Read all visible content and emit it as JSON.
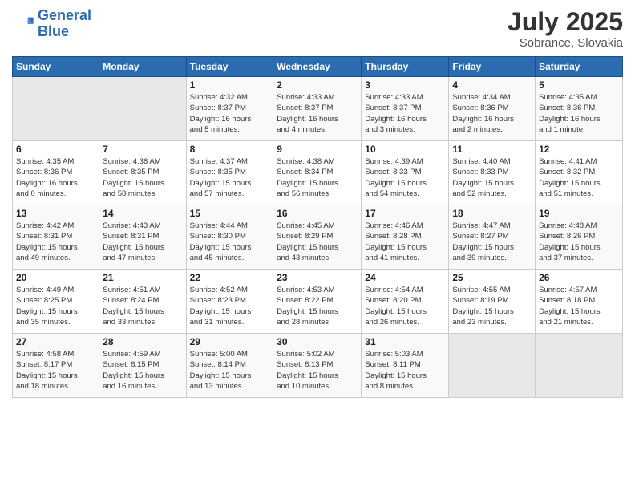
{
  "header": {
    "logo_line1": "General",
    "logo_line2": "Blue",
    "month": "July 2025",
    "location": "Sobrance, Slovakia"
  },
  "columns": [
    "Sunday",
    "Monday",
    "Tuesday",
    "Wednesday",
    "Thursday",
    "Friday",
    "Saturday"
  ],
  "weeks": [
    {
      "days": [
        {
          "num": "",
          "info": ""
        },
        {
          "num": "",
          "info": ""
        },
        {
          "num": "1",
          "info": "Sunrise: 4:32 AM\nSunset: 8:37 PM\nDaylight: 16 hours\nand 5 minutes."
        },
        {
          "num": "2",
          "info": "Sunrise: 4:33 AM\nSunset: 8:37 PM\nDaylight: 16 hours\nand 4 minutes."
        },
        {
          "num": "3",
          "info": "Sunrise: 4:33 AM\nSunset: 8:37 PM\nDaylight: 16 hours\nand 3 minutes."
        },
        {
          "num": "4",
          "info": "Sunrise: 4:34 AM\nSunset: 8:36 PM\nDaylight: 16 hours\nand 2 minutes."
        },
        {
          "num": "5",
          "info": "Sunrise: 4:35 AM\nSunset: 8:36 PM\nDaylight: 16 hours\nand 1 minute."
        }
      ]
    },
    {
      "days": [
        {
          "num": "6",
          "info": "Sunrise: 4:35 AM\nSunset: 8:36 PM\nDaylight: 16 hours\nand 0 minutes."
        },
        {
          "num": "7",
          "info": "Sunrise: 4:36 AM\nSunset: 8:35 PM\nDaylight: 15 hours\nand 58 minutes."
        },
        {
          "num": "8",
          "info": "Sunrise: 4:37 AM\nSunset: 8:35 PM\nDaylight: 15 hours\nand 57 minutes."
        },
        {
          "num": "9",
          "info": "Sunrise: 4:38 AM\nSunset: 8:34 PM\nDaylight: 15 hours\nand 56 minutes."
        },
        {
          "num": "10",
          "info": "Sunrise: 4:39 AM\nSunset: 8:33 PM\nDaylight: 15 hours\nand 54 minutes."
        },
        {
          "num": "11",
          "info": "Sunrise: 4:40 AM\nSunset: 8:33 PM\nDaylight: 15 hours\nand 52 minutes."
        },
        {
          "num": "12",
          "info": "Sunrise: 4:41 AM\nSunset: 8:32 PM\nDaylight: 15 hours\nand 51 minutes."
        }
      ]
    },
    {
      "days": [
        {
          "num": "13",
          "info": "Sunrise: 4:42 AM\nSunset: 8:31 PM\nDaylight: 15 hours\nand 49 minutes."
        },
        {
          "num": "14",
          "info": "Sunrise: 4:43 AM\nSunset: 8:31 PM\nDaylight: 15 hours\nand 47 minutes."
        },
        {
          "num": "15",
          "info": "Sunrise: 4:44 AM\nSunset: 8:30 PM\nDaylight: 15 hours\nand 45 minutes."
        },
        {
          "num": "16",
          "info": "Sunrise: 4:45 AM\nSunset: 8:29 PM\nDaylight: 15 hours\nand 43 minutes."
        },
        {
          "num": "17",
          "info": "Sunrise: 4:46 AM\nSunset: 8:28 PM\nDaylight: 15 hours\nand 41 minutes."
        },
        {
          "num": "18",
          "info": "Sunrise: 4:47 AM\nSunset: 8:27 PM\nDaylight: 15 hours\nand 39 minutes."
        },
        {
          "num": "19",
          "info": "Sunrise: 4:48 AM\nSunset: 8:26 PM\nDaylight: 15 hours\nand 37 minutes."
        }
      ]
    },
    {
      "days": [
        {
          "num": "20",
          "info": "Sunrise: 4:49 AM\nSunset: 8:25 PM\nDaylight: 15 hours\nand 35 minutes."
        },
        {
          "num": "21",
          "info": "Sunrise: 4:51 AM\nSunset: 8:24 PM\nDaylight: 15 hours\nand 33 minutes."
        },
        {
          "num": "22",
          "info": "Sunrise: 4:52 AM\nSunset: 8:23 PM\nDaylight: 15 hours\nand 31 minutes."
        },
        {
          "num": "23",
          "info": "Sunrise: 4:53 AM\nSunset: 8:22 PM\nDaylight: 15 hours\nand 28 minutes."
        },
        {
          "num": "24",
          "info": "Sunrise: 4:54 AM\nSunset: 8:20 PM\nDaylight: 15 hours\nand 26 minutes."
        },
        {
          "num": "25",
          "info": "Sunrise: 4:55 AM\nSunset: 8:19 PM\nDaylight: 15 hours\nand 23 minutes."
        },
        {
          "num": "26",
          "info": "Sunrise: 4:57 AM\nSunset: 8:18 PM\nDaylight: 15 hours\nand 21 minutes."
        }
      ]
    },
    {
      "days": [
        {
          "num": "27",
          "info": "Sunrise: 4:58 AM\nSunset: 8:17 PM\nDaylight: 15 hours\nand 18 minutes."
        },
        {
          "num": "28",
          "info": "Sunrise: 4:59 AM\nSunset: 8:15 PM\nDaylight: 15 hours\nand 16 minutes."
        },
        {
          "num": "29",
          "info": "Sunrise: 5:00 AM\nSunset: 8:14 PM\nDaylight: 15 hours\nand 13 minutes."
        },
        {
          "num": "30",
          "info": "Sunrise: 5:02 AM\nSunset: 8:13 PM\nDaylight: 15 hours\nand 10 minutes."
        },
        {
          "num": "31",
          "info": "Sunrise: 5:03 AM\nSunset: 8:11 PM\nDaylight: 15 hours\nand 8 minutes."
        },
        {
          "num": "",
          "info": ""
        },
        {
          "num": "",
          "info": ""
        }
      ]
    }
  ]
}
